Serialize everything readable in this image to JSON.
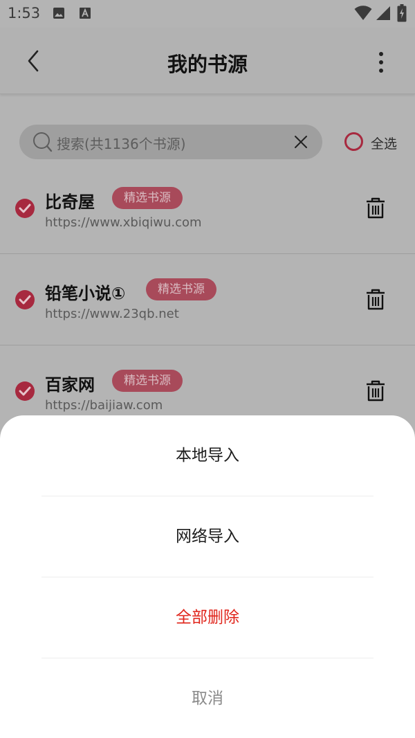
{
  "status_bar": {
    "time": "1:53",
    "icons": [
      "image-icon",
      "text-a-icon",
      "wifi-icon",
      "signal-icon",
      "battery-charging-icon"
    ]
  },
  "header": {
    "title": "我的书源",
    "back_icon": "chevron-left-icon",
    "more_icon": "more-vertical-icon"
  },
  "search": {
    "placeholder": "搜索(共1136个书源)",
    "clear_icon": "close-icon"
  },
  "select_all": {
    "label": "全选",
    "checked": false
  },
  "sources": [
    {
      "name": "比奇屋",
      "tag": "精选书源",
      "url": "https://www.xbiqiwu.com",
      "checked": true
    },
    {
      "name": "铅笔小说①",
      "tag": "精选书源",
      "url": "https://www.23qb.net",
      "checked": true
    },
    {
      "name": "百家网",
      "tag": "精选书源",
      "url": "https://baijiaw.com",
      "checked": true
    }
  ],
  "sheet": {
    "options": [
      {
        "label": "本地导入",
        "style": "normal"
      },
      {
        "label": "网络导入",
        "style": "normal"
      },
      {
        "label": "全部删除",
        "style": "danger"
      },
      {
        "label": "取消",
        "style": "muted"
      }
    ]
  },
  "colors": {
    "accent": "#a7293f",
    "danger": "#e0261c",
    "tag_background": "#a84a5a",
    "overlay_background": "#b4b4b4",
    "sheet_background": "#ffffff"
  }
}
